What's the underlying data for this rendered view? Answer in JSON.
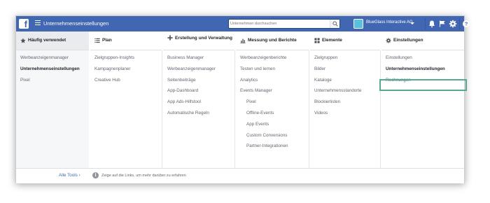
{
  "topbar": {
    "logo": "f",
    "title": "Unternehmenseinstellungen",
    "search_placeholder": "Unternehmen durchsuchen",
    "account_name": "BlueGlass Interactive AG",
    "icons": [
      "hamburger-icon",
      "search-icon",
      "bell-icon",
      "flag-icon",
      "gear-icon",
      "help-icon"
    ]
  },
  "columns": [
    {
      "title": "Häufig verwendet",
      "icon": "star-icon",
      "items": [
        {
          "label": "Werbeanzeigenmanager"
        },
        {
          "label": "Unternehmenseinstellungen"
        },
        {
          "label": "Pixel"
        }
      ]
    },
    {
      "title": "Plan",
      "icon": "list-icon",
      "items": [
        {
          "label": "Zielgruppen-Insights"
        },
        {
          "label": "Kampagnenplaner"
        },
        {
          "label": "Creative Hub"
        }
      ]
    },
    {
      "title": "Erstellung und Verwaltung",
      "icon": "plus-icon",
      "items": [
        {
          "label": "Business Manager"
        },
        {
          "label": "Werbeanzeigenmanager"
        },
        {
          "label": "Seitenbeiträge"
        },
        {
          "label": "App-Dashboard"
        },
        {
          "label": "App Ads-Hilfstool"
        },
        {
          "label": "Automatische Regeln"
        }
      ]
    },
    {
      "title": "Messung und Berichte",
      "icon": "bar-chart-icon",
      "items": [
        {
          "label": "Werbeanzeigenberichte"
        },
        {
          "label": "Testen und lernen"
        },
        {
          "label": "Analytics"
        },
        {
          "label": "Events Manager"
        },
        {
          "label": "Pixel"
        },
        {
          "label": "Offline-Events"
        },
        {
          "label": "App Events"
        },
        {
          "label": "Custom Conversions"
        },
        {
          "label": "Partner-Integrationen"
        }
      ]
    },
    {
      "title": "Elemente",
      "icon": "grid-icon",
      "items": [
        {
          "label": "Zielgruppen"
        },
        {
          "label": "Bilder"
        },
        {
          "label": "Kataloge"
        },
        {
          "label": "Unternehmensstandorte"
        },
        {
          "label": "Blockierlisten"
        },
        {
          "label": "Videos"
        }
      ]
    },
    {
      "title": "Einstellungen",
      "icon": "gear-icon",
      "items": [
        {
          "label": "Einstellungen"
        },
        {
          "label": "Unternehmenseinstellungen"
        },
        {
          "label": "Rechnungen"
        }
      ]
    }
  ],
  "footer": {
    "all_tools": "Alle Tools",
    "all_tools_arrow": "›",
    "info_icon": "i",
    "info_text": "Zeige auf die Links, um mehr darüber zu erfahren"
  },
  "colors": {
    "topbar": "#4267b2",
    "highlight": "#55a891",
    "link": "#4267b2"
  }
}
